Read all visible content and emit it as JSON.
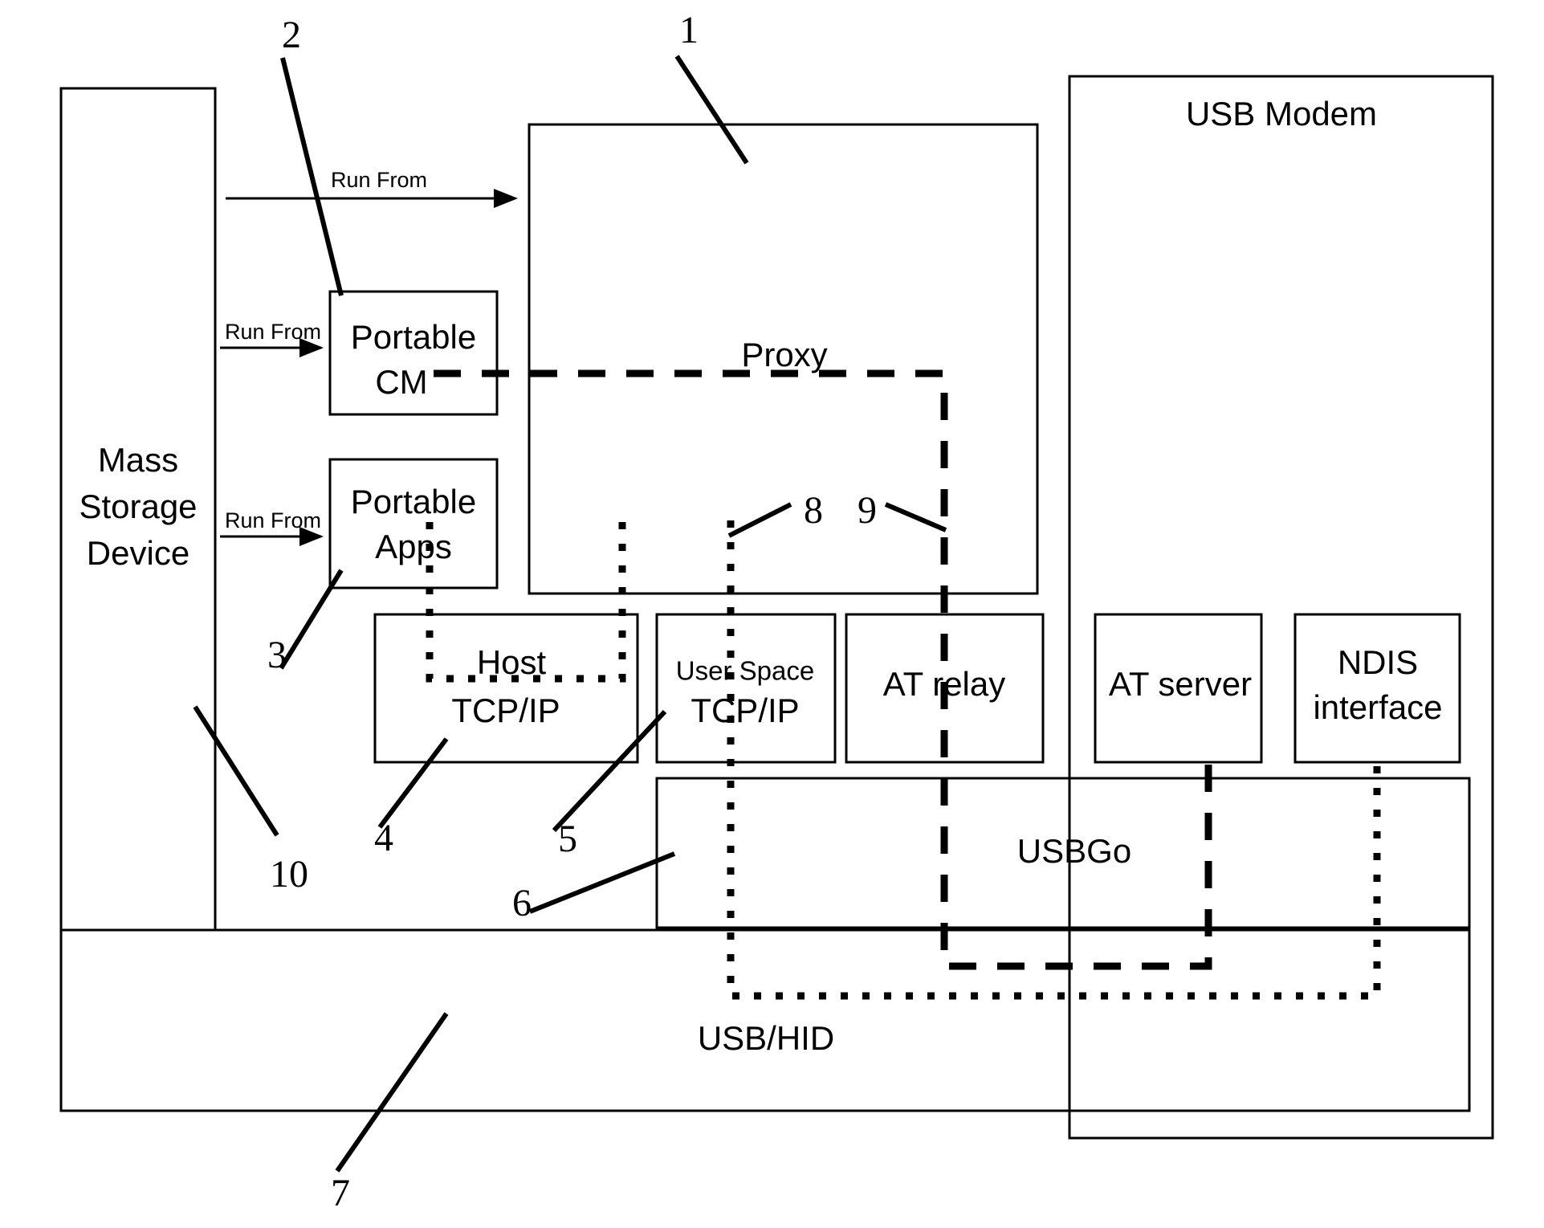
{
  "diagram": {
    "title": "USB Modem Architecture Block Diagram",
    "colors": {
      "stroke": "#000000",
      "background": "#ffffff"
    },
    "boxes": {
      "mass_storage_device": {
        "label_line1": "Mass",
        "label_line2": "Storage",
        "label_line3": "Device"
      },
      "portable_cm": {
        "label_line1": "Portable",
        "label_line2": "CM"
      },
      "portable_apps": {
        "label_line1": "Portable",
        "label_line2": "Apps"
      },
      "proxy_container": {
        "label": ""
      },
      "usb_modem": {
        "label": "USB Modem"
      },
      "host_tcpip": {
        "label_line1": "Host",
        "label_line2": "TCP/IP"
      },
      "user_space_tcpip": {
        "label_line1": "User Space",
        "label_line2": "TCP/IP"
      },
      "at_relay": {
        "label": "AT relay"
      },
      "at_server": {
        "label": "AT server"
      },
      "ndis_interface": {
        "label_line1": "NDIS",
        "label_line2": "interface"
      },
      "usbgo": {
        "label": "USBGo"
      },
      "usb_hid": {
        "label": "USB/HID"
      }
    },
    "connector_labels": {
      "run_from_top": "Run From",
      "run_from_cm": "Run From",
      "run_from_apps": "Run From",
      "proxy": "Proxy"
    },
    "reference_numbers": [
      {
        "id": "ref-1",
        "value": "1"
      },
      {
        "id": "ref-2",
        "value": "2"
      },
      {
        "id": "ref-3",
        "value": "3"
      },
      {
        "id": "ref-4",
        "value": "4"
      },
      {
        "id": "ref-5",
        "value": "5"
      },
      {
        "id": "ref-6",
        "value": "6"
      },
      {
        "id": "ref-7",
        "value": "7"
      },
      {
        "id": "ref-8",
        "value": "8"
      },
      {
        "id": "ref-9",
        "value": "9"
      },
      {
        "id": "ref-10",
        "value": "10"
      }
    ]
  }
}
